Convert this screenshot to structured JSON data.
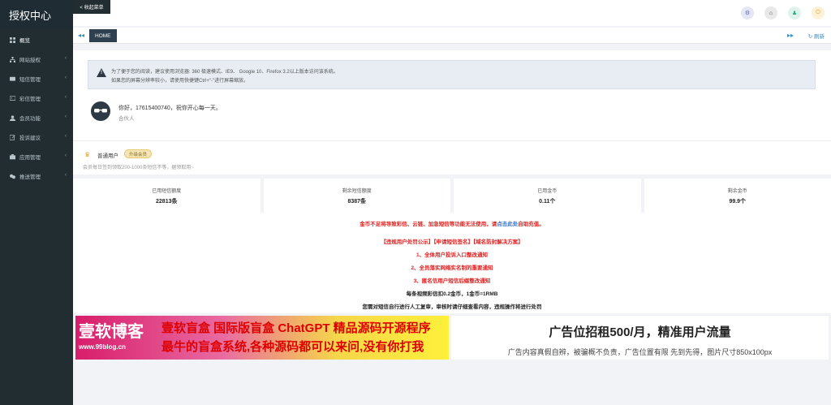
{
  "sidebar": {
    "brand": "授权中心",
    "collapse_label": "< 收起菜单",
    "items": [
      {
        "label": "概览",
        "icon": "dashboard-icon"
      },
      {
        "label": "网站授权",
        "icon": "sitemap-icon"
      },
      {
        "label": "短信管理",
        "icon": "message-icon"
      },
      {
        "label": "彩信管理",
        "icon": "mms-icon"
      },
      {
        "label": "会员功能",
        "icon": "user-icon"
      },
      {
        "label": "投诉建议",
        "icon": "edit-icon"
      },
      {
        "label": "应用管理",
        "icon": "app-icon"
      },
      {
        "label": "推送管理",
        "icon": "push-icon"
      }
    ]
  },
  "tabs": {
    "home": "HOME",
    "refresh": "刷新"
  },
  "alert": {
    "line1": "为了便于您的阅读，建议使用浏览器: 360 极速模式、IE9、 Google 10、Firefox 3.2以上版本访问该系统。",
    "line2": "如果您的屏幕分辨率较小，请使用快捷键Ctrl+\"-\"进行屏幕缩放。"
  },
  "user": {
    "greeting": "你好，17615400740，祝你开心每一天。",
    "role": "合伙人"
  },
  "level": {
    "name": "普通用户",
    "badge": "升级会员",
    "desc": "会员每日签到领取200-1000条短信不等，据领取用~"
  },
  "stats": [
    {
      "label": "已用短信额度",
      "value": "22813条"
    },
    {
      "label": "剩余短信额度",
      "value": "8387条"
    },
    {
      "label": "已用金币",
      "value": "0.11个"
    },
    {
      "label": "剩余金币",
      "value": "99.9个"
    }
  ],
  "notice": {
    "line1_a": "金币不足将导致彩信、云链、加急短信等功能无法使用，请",
    "line1_link": "点击此处",
    "line1_b": "自助充值。",
    "line2": "【违规用户处罚公示】【申请短信签名】【域名防封解决方案】",
    "line3": "1、全体用户投诉入口整改通知",
    "line4": "2、全员落实网络实名制的重要通知",
    "line5": "3、匿名信用户短信后缀整改通知",
    "line6": "每条视频彩信扣0.2金币，1金币=1RMB",
    "line7": "您需对短信自行进行人工复审，审核时请仔细查看内容，违规操作将进行处罚"
  },
  "ad": {
    "logo": "壹软博客",
    "url": "www.99blog.cn",
    "left_line1": "壹软盲盒 国际版盲盒 ChatGPT 精品源码开源程序",
    "left_line2": "最牛的盲盒系统,各种源码都可以来问,没有你打我",
    "right_title": "广告位招租500/月，精准用户流量",
    "right_sub": "广告内容真假自辨，被骗概不负责，广告位置有限 先到先得，图片尺寸850x100px"
  }
}
